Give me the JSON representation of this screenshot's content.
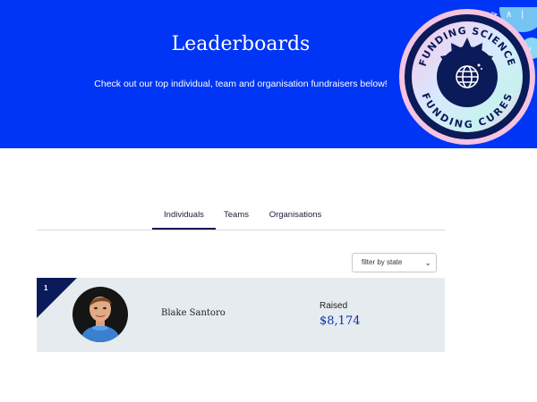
{
  "hero": {
    "title": "Leaderboards",
    "subtitle": "Check out our top individual, team and organisation fundraisers below!",
    "background_color": "#0035f5",
    "badge": {
      "top_text": "FUNDING SCIENCE",
      "bottom_text": "FUNDING CURES",
      "icon": "globe-icon"
    }
  },
  "tabs": [
    {
      "label": "Individuals",
      "active": true
    },
    {
      "label": "Teams",
      "active": false
    },
    {
      "label": "Organisations",
      "active": false
    }
  ],
  "filter": {
    "selected": "filter by state"
  },
  "leaderboard": [
    {
      "rank": "1",
      "name": "Blake Santoro",
      "raised_label": "Raised",
      "raised_amount": "$8,174"
    }
  ],
  "colors": {
    "accent": "#0035f5",
    "navy": "#0b1a58",
    "row_bg": "#e6ebf0",
    "amount": "#0a2fa8"
  }
}
